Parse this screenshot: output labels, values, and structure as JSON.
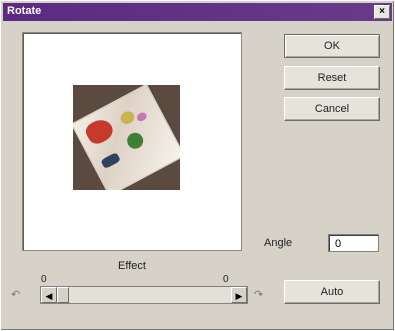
{
  "window": {
    "title": "Rotate"
  },
  "buttons": {
    "ok": "OK",
    "reset": "Reset",
    "cancel": "Cancel",
    "auto": "Auto"
  },
  "angle": {
    "label": "Angle",
    "value": "0"
  },
  "effect": {
    "label": "Effect",
    "min": "0",
    "max": "0"
  },
  "icons": {
    "close": "close-icon",
    "rotate_left": "rotate-left-icon",
    "rotate_right": "rotate-right-icon"
  }
}
